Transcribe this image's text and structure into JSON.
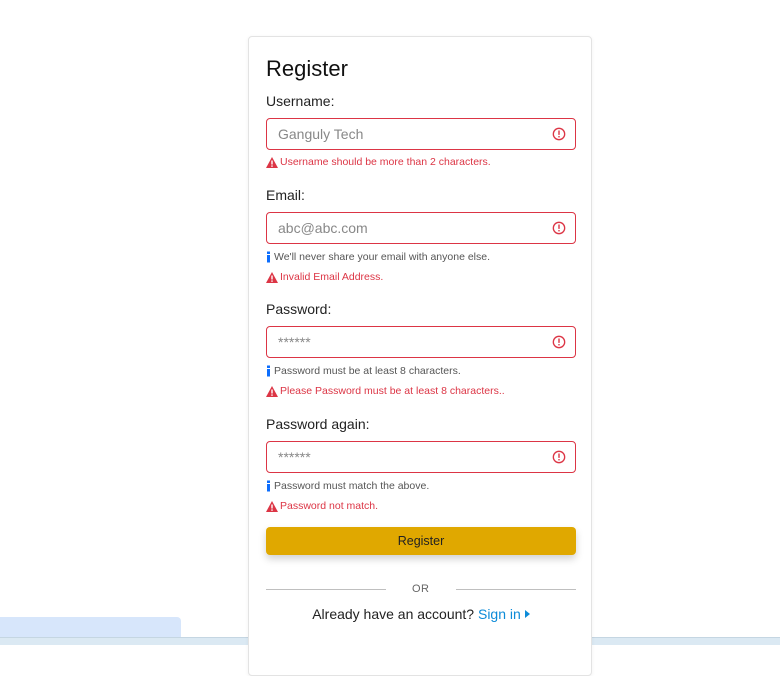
{
  "form": {
    "title": "Register",
    "username": {
      "label": "Username:",
      "placeholder": "Ganguly Tech",
      "error": "Username should be more than 2 characters."
    },
    "email": {
      "label": "Email:",
      "placeholder": "abc@abc.com",
      "help": "We'll never share your email with anyone else.",
      "error": "Invalid Email Address."
    },
    "password": {
      "label": "Password:",
      "placeholder": "******",
      "help": "Password must be at least 8 characters.",
      "error": "Please Password must be at least 8 characters.."
    },
    "password_again": {
      "label": "Password again:",
      "placeholder": "******",
      "help": "Password must match the above.",
      "error": "Password not match."
    },
    "submit_label": "Register",
    "divider_text": "OR",
    "signin_prompt": "Already have an account?",
    "signin_link": "Sign in"
  },
  "colors": {
    "error": "#dc3545",
    "button": "#e0a800",
    "link": "#0d8bd8",
    "info": "#0d6efd"
  },
  "icons": [
    "exclamation-circle-icon",
    "warning-triangle-icon",
    "info-icon",
    "caret-right-icon"
  ]
}
